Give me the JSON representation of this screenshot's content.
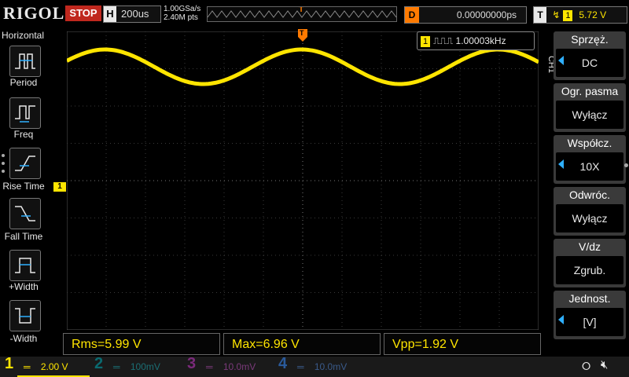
{
  "header": {
    "logo": "RIGOL",
    "run_state": "STOP",
    "h_key": "H",
    "timebase": "200us",
    "sample_rate": "1.00GSa/s",
    "mem_depth": "2.40M pts",
    "trigger_marker": "T",
    "delay_key": "D",
    "delay": "0.00000000ps",
    "trig_key": "T",
    "trig_source": "1",
    "trig_level": "5.72 V"
  },
  "left_menu": {
    "title": "Horizontal",
    "items": [
      {
        "label": "Period"
      },
      {
        "label": "Freq"
      },
      {
        "label": "Rise Time"
      },
      {
        "label": "Fall Time"
      },
      {
        "label": "+Width"
      },
      {
        "label": "-Width"
      }
    ]
  },
  "screen": {
    "freq_channel": "1",
    "freq_value": "1.00003kHz",
    "ch_marker": "1",
    "trigger_pos_marker": "T"
  },
  "right_menu": {
    "channel_label": "CH1",
    "items": [
      {
        "title": "Sprzęż.",
        "value": "DC"
      },
      {
        "title": "Ogr. pasma",
        "value": "Wyłącz"
      },
      {
        "title": "Współcz.",
        "value": "10X"
      },
      {
        "title": "Odwróc.",
        "value": "Wyłącz"
      },
      {
        "title": "V/dz",
        "value": "Zgrub."
      },
      {
        "title": "Jednost.",
        "value": "[V]"
      }
    ]
  },
  "measurements": [
    {
      "text": "Rms=5.99 V"
    },
    {
      "text": "Max=6.96 V"
    },
    {
      "text": "Vpp=1.92 V"
    }
  ],
  "channels": [
    {
      "num": "1",
      "scale": "2.00 V",
      "color": "#ffe500"
    },
    {
      "num": "2",
      "scale": "100mV",
      "color": "#00c8d0"
    },
    {
      "num": "3",
      "scale": "10.0mV",
      "color": "#ff40ff"
    },
    {
      "num": "4",
      "scale": "10.0mV",
      "color": "#2f8cff"
    }
  ],
  "colors": {
    "trace": "#ffe500",
    "accent_orange": "#ff7a00",
    "stop_red": "#c0281e",
    "menu_arrow": "#2fb0ff"
  }
}
